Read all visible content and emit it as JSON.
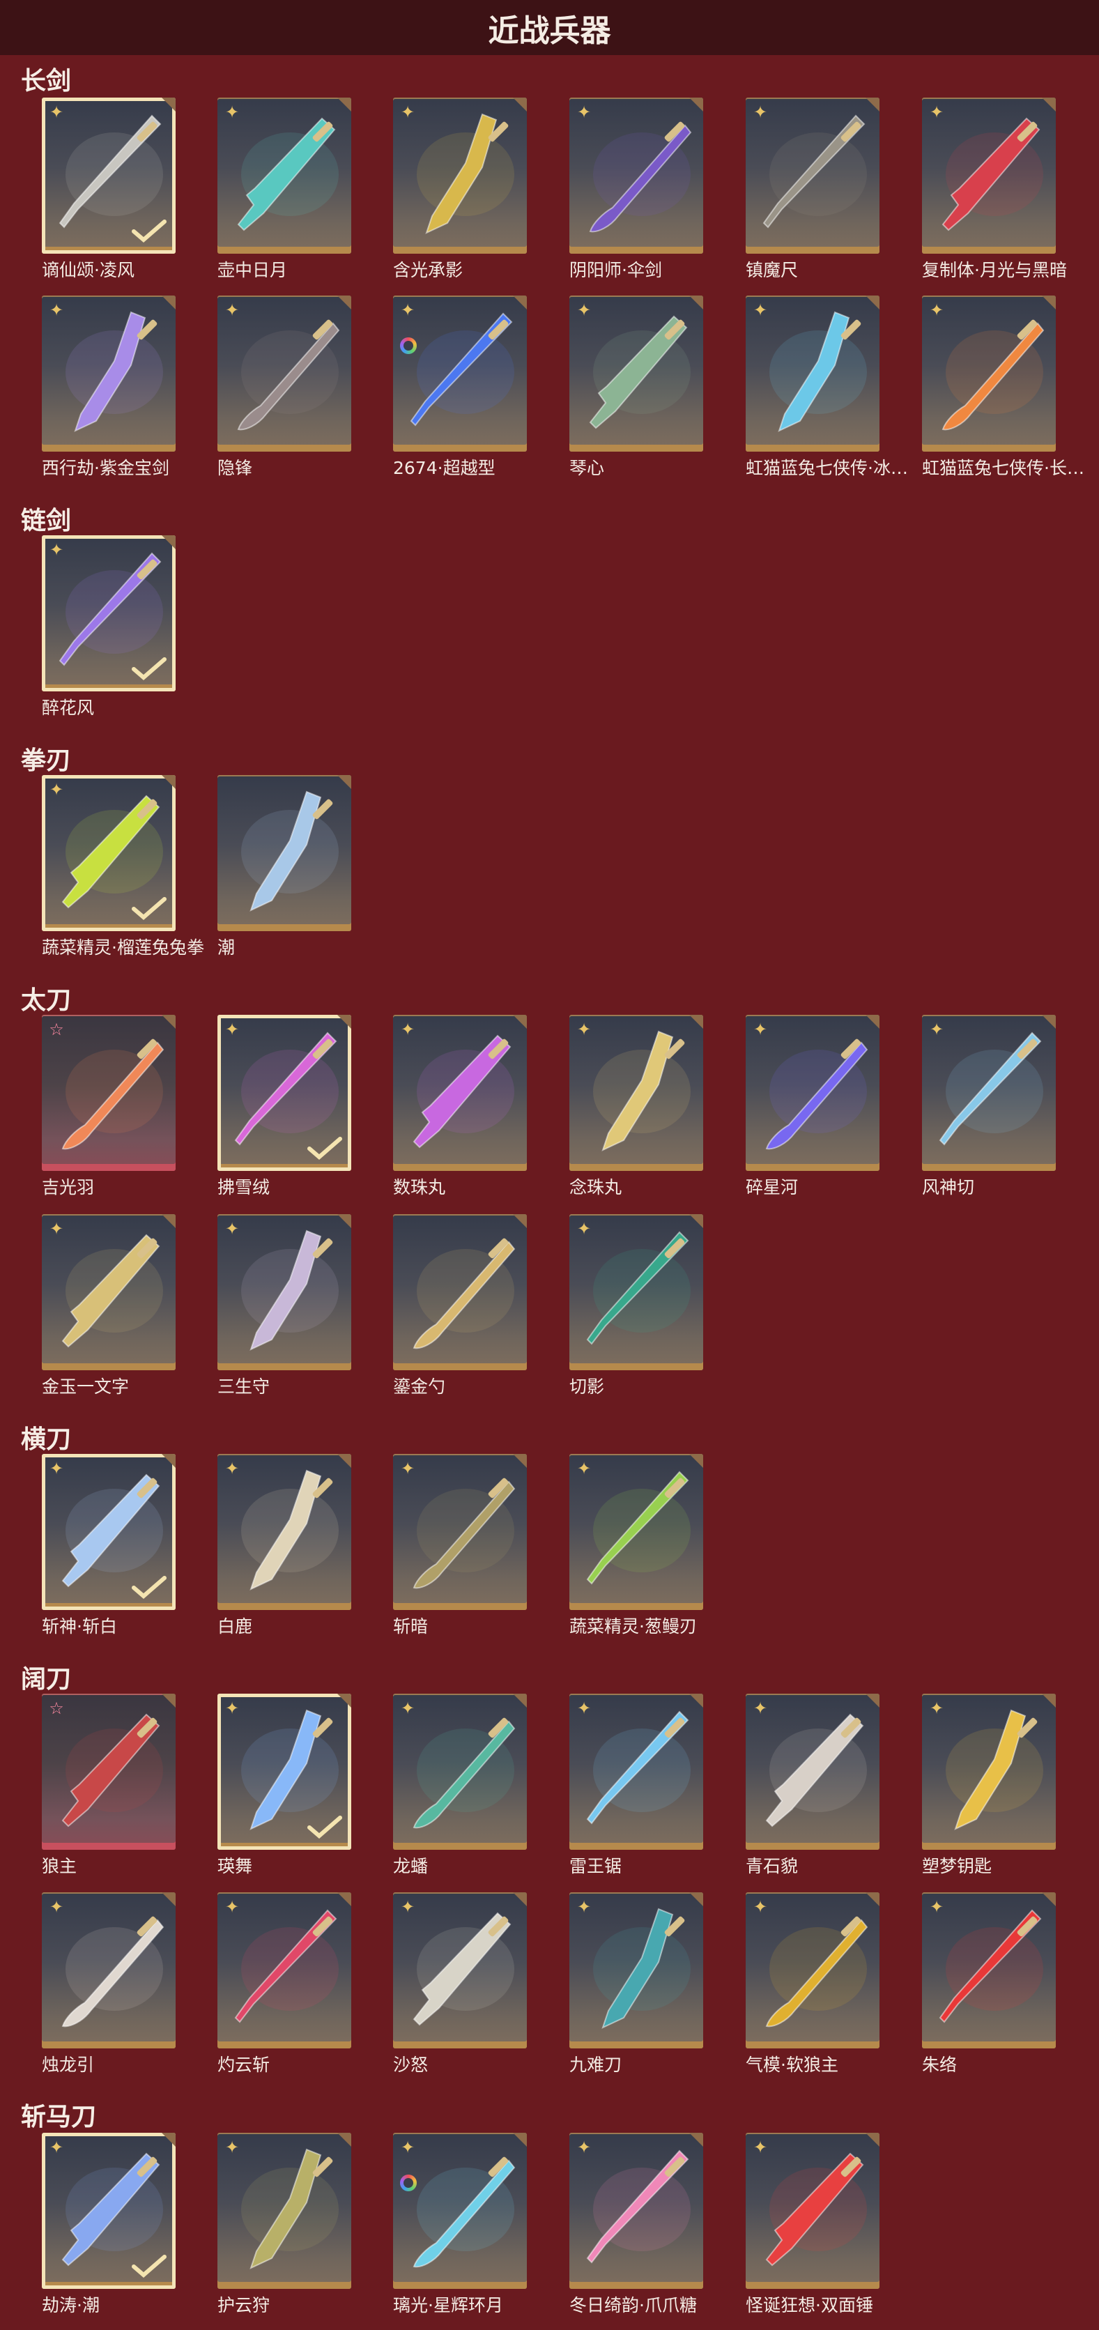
{
  "title": "近战兵器",
  "check_icon": "checkmark-icon",
  "categories": [
    {
      "name": "长剑",
      "items": [
        {
          "name": "谪仙颂·凌风",
          "badge": "gold",
          "selected": true,
          "color": "#c8c6c0"
        },
        {
          "name": "壶中日月",
          "badge": "gold",
          "color": "#59c8c0"
        },
        {
          "name": "含光承影",
          "badge": "gold",
          "color": "#d8b84c"
        },
        {
          "name": "阴阳师·伞剑",
          "badge": "gold",
          "color": "#7a5ac8"
        },
        {
          "name": "镇魔尺",
          "badge": "gold",
          "color": "#9a9488"
        },
        {
          "name": "复制体·月光与黑暗",
          "badge": "gold",
          "color": "#d8404c"
        },
        {
          "name": "西行劫·紫金宝剑",
          "badge": "gold",
          "color": "#a88ce8"
        },
        {
          "name": "隐锋",
          "badge": "gold",
          "color": "#9a8c8c"
        },
        {
          "name": "2674·超越型",
          "badge": "ring",
          "color": "#4c78f0"
        },
        {
          "name": "琴心",
          "badge": "gold",
          "color": "#8cb494"
        },
        {
          "name": "虹猫蓝兔七侠传·冰魄...",
          "badge": "gold",
          "color": "#6cc8e8"
        },
        {
          "name": "虹猫蓝兔七侠传·长虹...",
          "badge": "gold",
          "color": "#f08840"
        }
      ]
    },
    {
      "name": "链剑",
      "items": [
        {
          "name": "醉花风",
          "badge": "gold",
          "selected": true,
          "color": "#9c78e8"
        }
      ]
    },
    {
      "name": "拳刃",
      "items": [
        {
          "name": "蔬菜精灵·榴莲兔兔拳",
          "badge": "gold",
          "selected": true,
          "color": "#c8e040"
        },
        {
          "name": "潮",
          "badge": "none",
          "color": "#a8c8e8"
        }
      ]
    },
    {
      "name": "太刀",
      "items": [
        {
          "name": "吉光羽",
          "badge": "pink",
          "red": true,
          "color": "#f08858"
        },
        {
          "name": "拂雪绒",
          "badge": "gold",
          "selected": true,
          "color": "#d868d8"
        },
        {
          "name": "数珠丸",
          "badge": "gold",
          "color": "#c868e0"
        },
        {
          "name": "念珠丸",
          "badge": "gold",
          "color": "#e0c878"
        },
        {
          "name": "碎星河",
          "badge": "gold",
          "color": "#7868f0"
        },
        {
          "name": "风神切",
          "badge": "gold",
          "color": "#88c8e8"
        },
        {
          "name": "金玉一文字",
          "badge": "gold",
          "color": "#d8c078"
        },
        {
          "name": "三生守",
          "badge": "gold",
          "color": "#c8b8d8"
        },
        {
          "name": "鎏金勺",
          "badge": "none",
          "color": "#d8b870"
        },
        {
          "name": "切影",
          "badge": "gold",
          "color": "#38a88c"
        }
      ]
    },
    {
      "name": "横刀",
      "items": [
        {
          "name": "斩神·斩白",
          "badge": "gold",
          "selected": true,
          "color": "#a8c8f0"
        },
        {
          "name": "白鹿",
          "badge": "gold",
          "color": "#e0d4b8"
        },
        {
          "name": "斩暗",
          "badge": "gold",
          "color": "#b0a068"
        },
        {
          "name": "蔬菜精灵·葱鳗刃",
          "badge": "gold",
          "color": "#98d050"
        }
      ]
    },
    {
      "name": "阔刀",
      "items": [
        {
          "name": "狼主",
          "badge": "pink",
          "red": true,
          "color": "#c84848"
        },
        {
          "name": "瑛舞",
          "badge": "gold",
          "selected": true,
          "color": "#88b8f8"
        },
        {
          "name": "龙蟠",
          "badge": "gold",
          "color": "#58b8a0"
        },
        {
          "name": "雷王锯",
          "badge": "gold",
          "color": "#78c8f0"
        },
        {
          "name": "青石貌",
          "badge": "gold",
          "color": "#d8d0c8"
        },
        {
          "name": "塑梦钥匙",
          "badge": "gold",
          "color": "#e8c048"
        },
        {
          "name": "烛龙引",
          "badge": "gold",
          "color": "#e0d8d0"
        },
        {
          "name": "灼云斩",
          "badge": "gold",
          "color": "#e04868"
        },
        {
          "name": "沙怒",
          "badge": "gold",
          "color": "#d8d4c8"
        },
        {
          "name": "九难刀",
          "badge": "gold",
          "color": "#48a8b0"
        },
        {
          "name": "气模·软狼主",
          "badge": "gold",
          "color": "#e0b030"
        },
        {
          "name": "朱络",
          "badge": "gold",
          "color": "#e83838"
        }
      ]
    },
    {
      "name": "斩马刀",
      "items": [
        {
          "name": "劫涛·潮",
          "badge": "gold",
          "selected": true,
          "color": "#88a8f0"
        },
        {
          "name": "护云狩",
          "badge": "gold",
          "color": "#b8b068"
        },
        {
          "name": "璃光·星辉环月",
          "badge": "ring",
          "color": "#70d0e8"
        },
        {
          "name": "冬日绮韵·爪爪糖",
          "badge": "gold",
          "color": "#f088b8"
        },
        {
          "name": "怪诞狂想·双面锤",
          "badge": "gold",
          "color": "#e84040"
        }
      ]
    }
  ]
}
